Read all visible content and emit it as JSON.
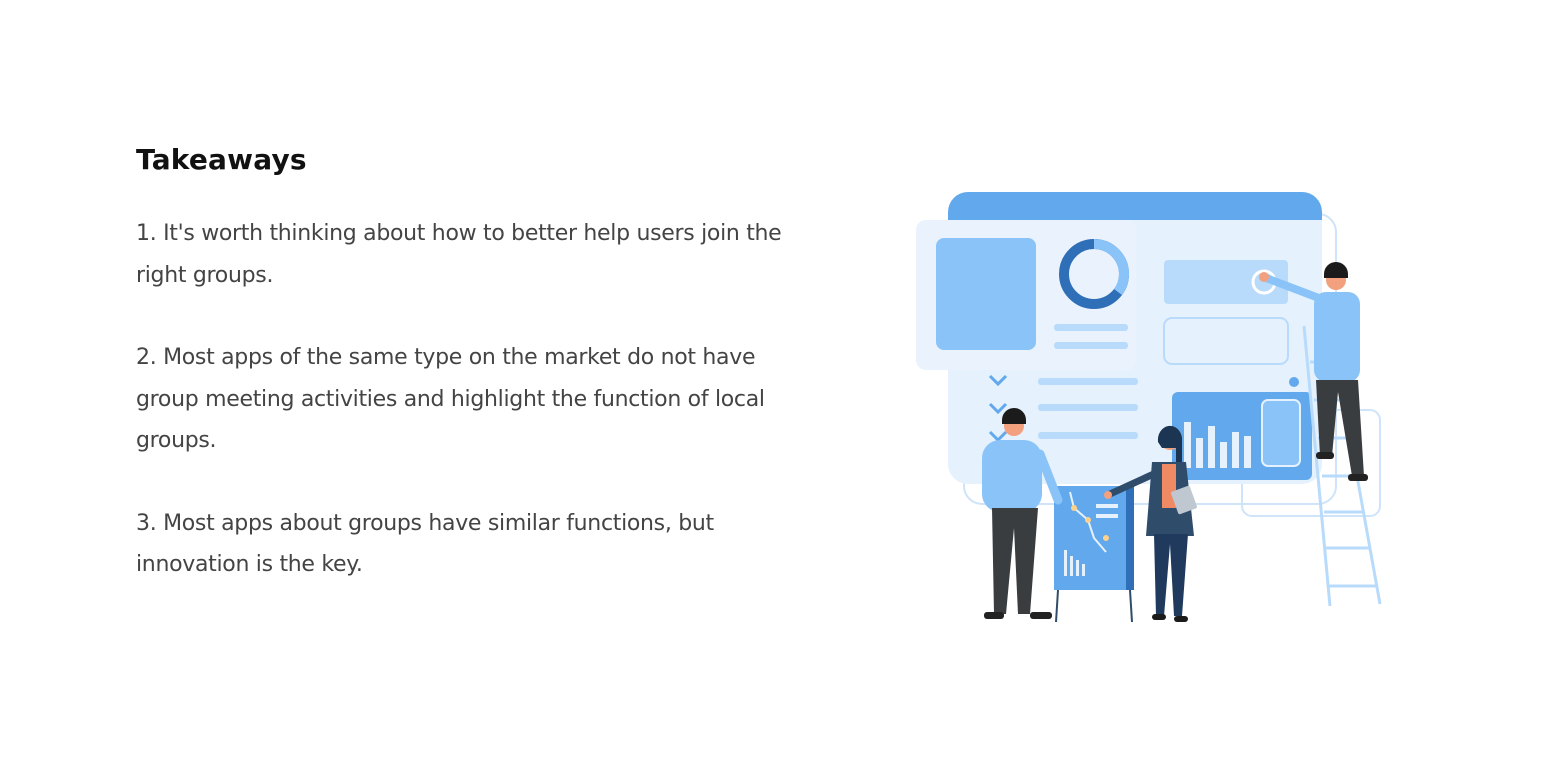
{
  "section": {
    "title": "Takeaways",
    "points": [
      "1. It's worth thinking about how to better help users join the right groups.",
      "2. Most apps of the same type on the market do not have group meeting activities and highlight the function of local groups.",
      "3. Most apps about groups have similar functions, but innovation is the key."
    ]
  },
  "colors": {
    "heading": "#111111",
    "body_text": "#444444",
    "illustration_primary": "#62a8ec",
    "illustration_light": "#e5f1fd",
    "illustration_mid": "#8ac3f8"
  }
}
